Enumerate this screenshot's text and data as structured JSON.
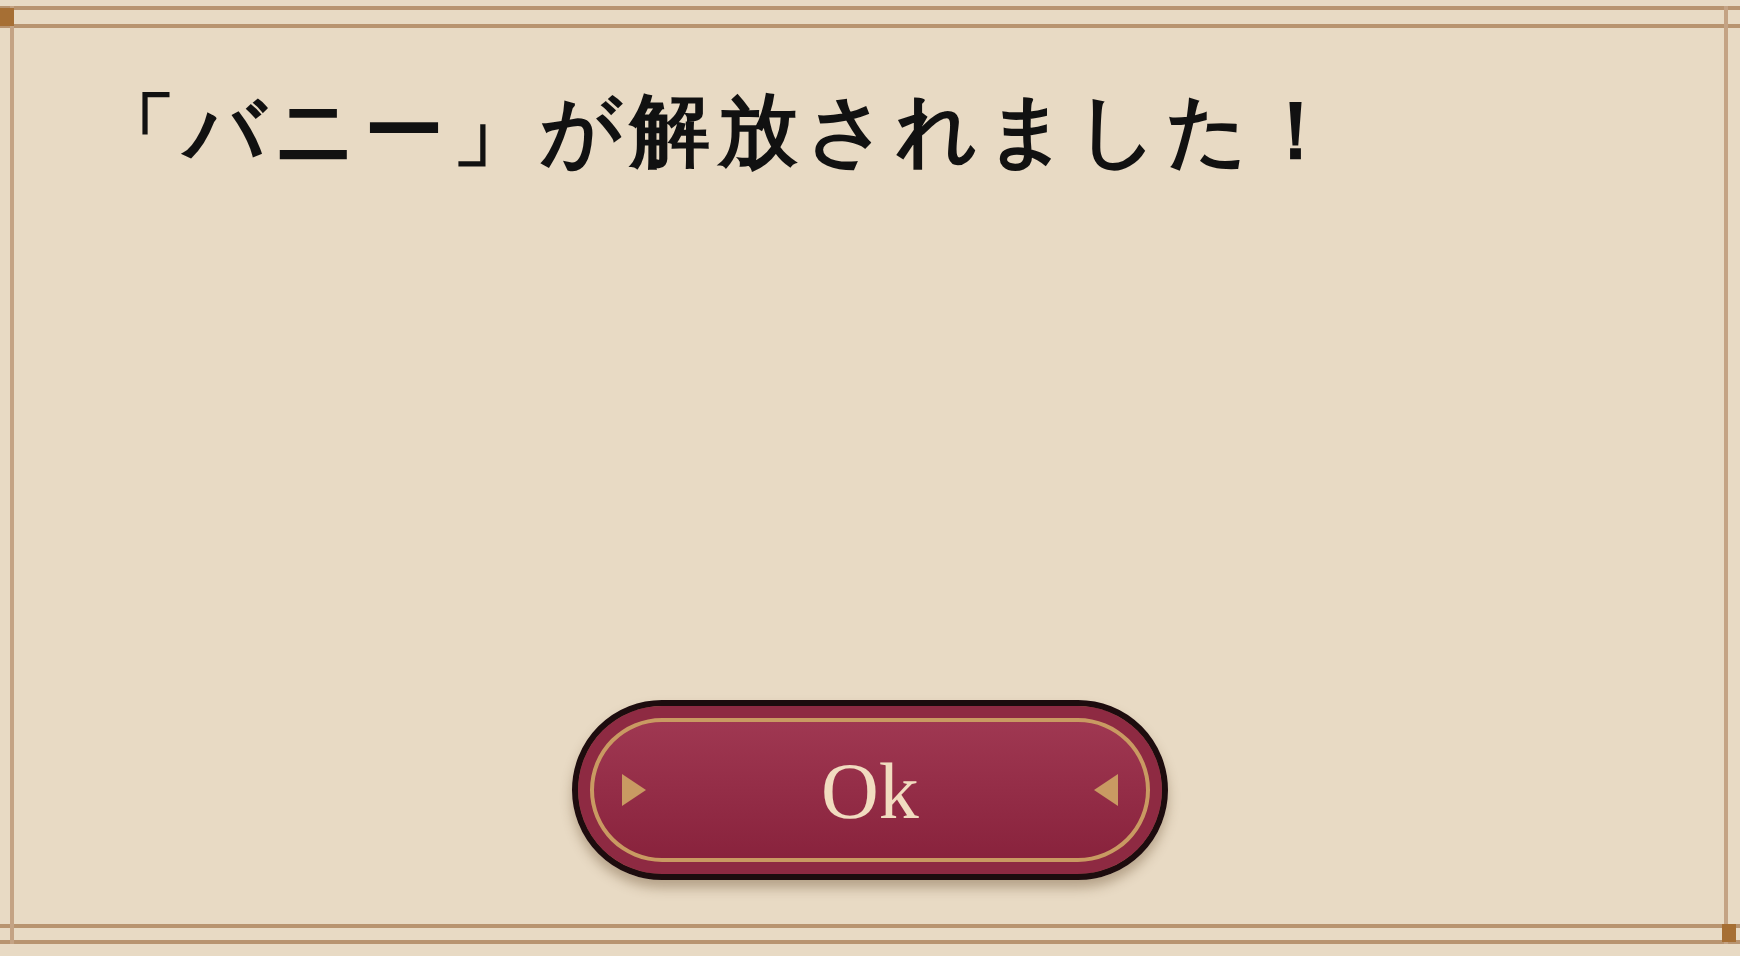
{
  "dialog": {
    "message": "「バニー」が解放されました！",
    "buttons": [
      {
        "kind": "primary",
        "label": "Ok"
      }
    ]
  }
}
